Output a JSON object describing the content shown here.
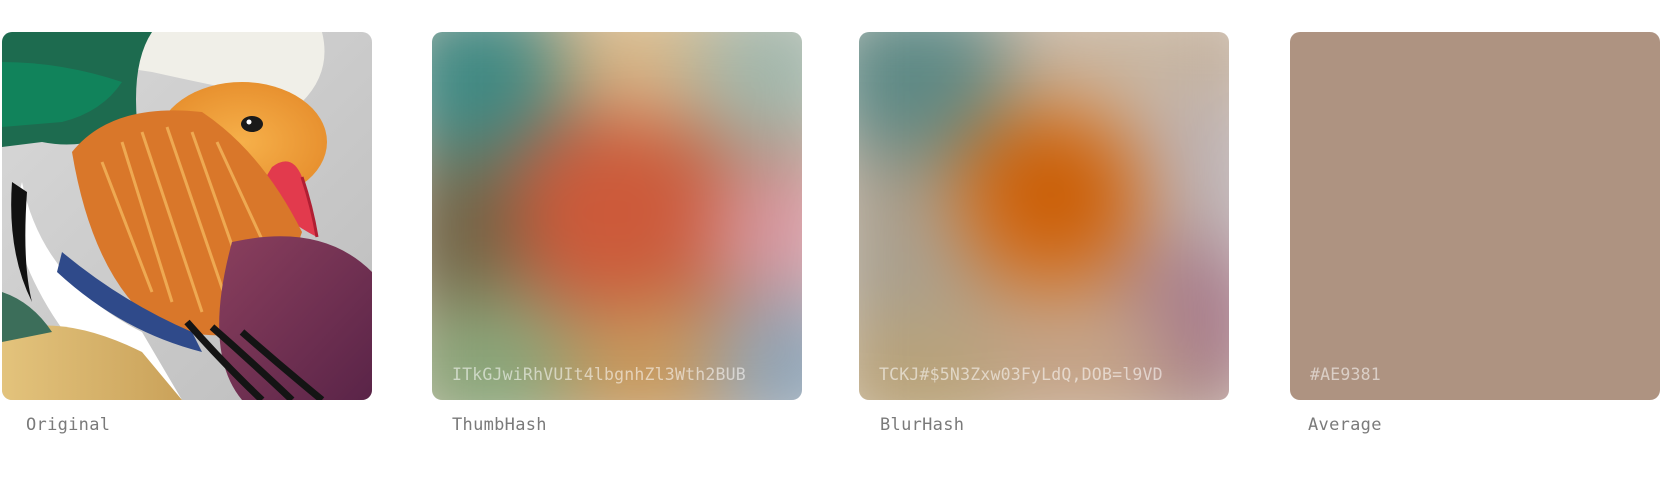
{
  "items": [
    {
      "caption": "Original",
      "hash": ""
    },
    {
      "caption": "ThumbHash",
      "hash": "ITkGJwiRhVUIt4lbgnhZl3Wth2BUB"
    },
    {
      "caption": "BlurHash",
      "hash": "TCKJ#$5N3Zxw03FyLdQ,DOB=l9VD"
    },
    {
      "caption": "Average",
      "hash": "#AE9381"
    }
  ],
  "colors": {
    "average": "#AE9381"
  }
}
